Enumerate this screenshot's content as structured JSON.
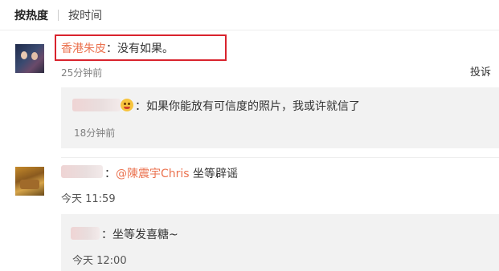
{
  "tabs": {
    "by_hot": "按热度",
    "by_time": "按时间"
  },
  "comment1": {
    "username": "香港朱皮",
    "colon": "：",
    "text": "没有如果。",
    "time": "25分钟前",
    "report_label": "投诉",
    "reply": {
      "colon": "：",
      "text": "如果你能放有可信度的照片，我或许就信了",
      "time": "18分钟前"
    }
  },
  "comment2": {
    "colon": "：",
    "mention": "@陳震宇Chris",
    "text": " 坐等辟谣",
    "time": "今天 11:59",
    "reply": {
      "colon": "：",
      "text": "坐等发喜糖~",
      "time": "今天 12:00"
    }
  },
  "colors": {
    "username": "#eb7350",
    "highlight_box": "#d9232d",
    "reply_bg": "#f2f2f2"
  }
}
